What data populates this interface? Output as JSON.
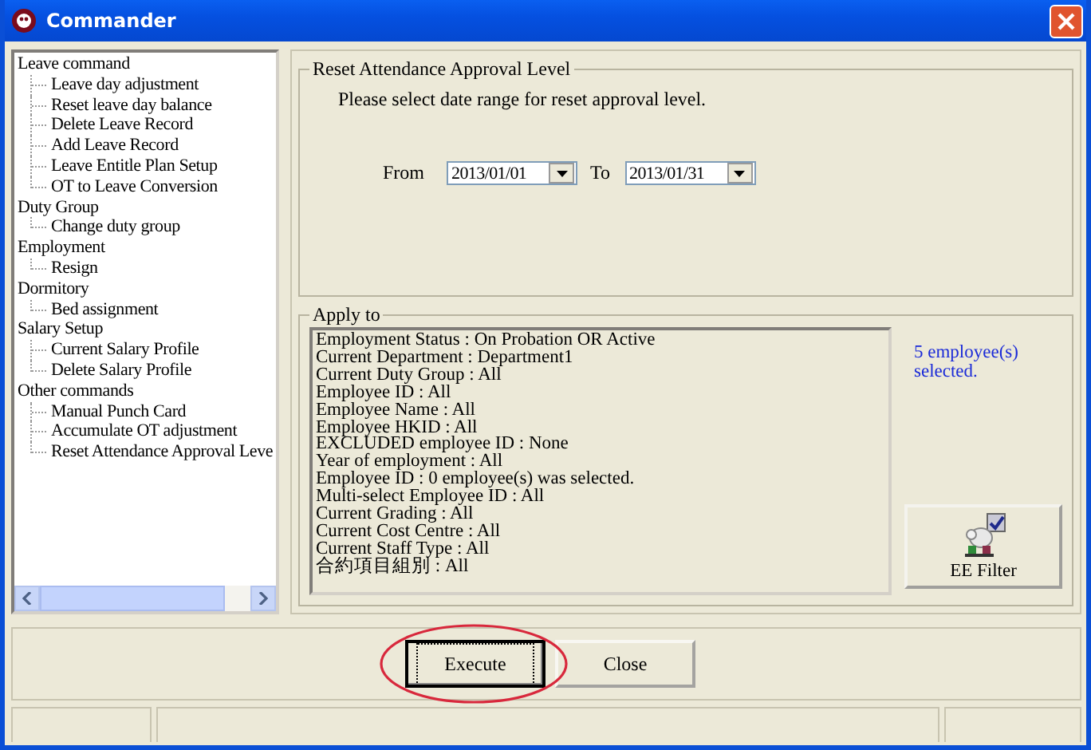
{
  "window": {
    "title": "Commander"
  },
  "tree": [
    {
      "label": "Leave command",
      "children": [
        {
          "label": "Leave day adjustment"
        },
        {
          "label": "Reset leave day balance"
        },
        {
          "label": "Delete Leave Record"
        },
        {
          "label": "Add Leave Record"
        },
        {
          "label": "Leave Entitle Plan Setup"
        },
        {
          "label": "OT to Leave Conversion"
        }
      ]
    },
    {
      "label": "Duty Group",
      "children": [
        {
          "label": "Change duty group"
        }
      ]
    },
    {
      "label": "Employment",
      "children": [
        {
          "label": "Resign"
        }
      ]
    },
    {
      "label": "Dormitory",
      "children": [
        {
          "label": "Bed assignment"
        }
      ]
    },
    {
      "label": "Salary Setup",
      "children": [
        {
          "label": "Current Salary Profile"
        },
        {
          "label": "Delete Salary Profile"
        }
      ]
    },
    {
      "label": "Other commands",
      "children": [
        {
          "label": "Manual Punch Card"
        },
        {
          "label": "Accumulate OT adjustment"
        },
        {
          "label": "Reset Attendance Approval Leve"
        }
      ]
    }
  ],
  "date_range_group": {
    "title": "Reset Attendance Approval Level",
    "instruction": "Please select date range for reset approval level.",
    "from_label": "From",
    "from_value": "2013/01/01",
    "to_label": "To",
    "to_value": "2013/01/31"
  },
  "apply_to": {
    "title": "Apply to",
    "criteria": [
      "Employment Status : On Probation OR Active",
      "Current Department : Department1",
      "Current Duty Group : All",
      "Employee ID : All",
      "Employee Name : All",
      "Employee HKID : All",
      "EXCLUDED employee ID : None",
      "Year of employment : All",
      "Employee ID : 0 employee(s) was selected.",
      "Multi-select Employee ID : All",
      "Current Grading : All",
      "Current Cost Centre : All",
      "Current Staff Type : All",
      "合約項目組別 : All"
    ],
    "selection_count": "5 employee(s) selected.",
    "filter_button": "EE Filter"
  },
  "buttons": [
    {
      "label": "Execute",
      "focused": true
    },
    {
      "label": "Close",
      "focused": false
    }
  ]
}
